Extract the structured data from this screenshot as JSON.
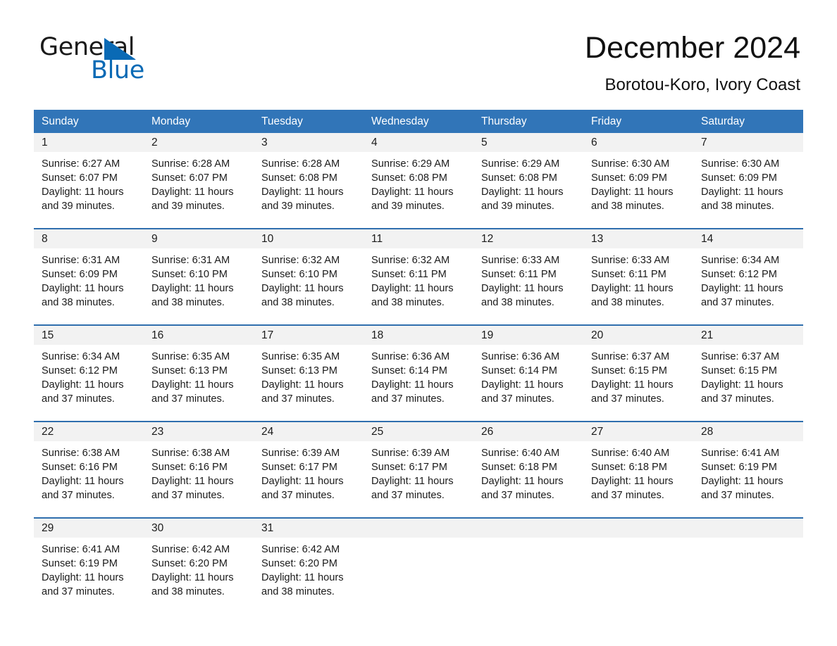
{
  "brand": {
    "name_part1": "General",
    "name_part2": "Blue",
    "triangle_color": "#0a6ab5"
  },
  "header": {
    "month_title": "December 2024",
    "location": "Borotou-Koro, Ivory Coast"
  },
  "theme": {
    "header_blue": "#3175b8",
    "row_divider_blue": "#2f6fae",
    "day_number_band": "#f2f2f2",
    "text_color": "#1b1b1b"
  },
  "calendar": {
    "weekdays": [
      "Sunday",
      "Monday",
      "Tuesday",
      "Wednesday",
      "Thursday",
      "Friday",
      "Saturday"
    ],
    "weeks": [
      [
        {
          "day": "1",
          "sunrise": "Sunrise: 6:27 AM",
          "sunset": "Sunset: 6:07 PM",
          "daylight": "Daylight: 11 hours and 39 minutes."
        },
        {
          "day": "2",
          "sunrise": "Sunrise: 6:28 AM",
          "sunset": "Sunset: 6:07 PM",
          "daylight": "Daylight: 11 hours and 39 minutes."
        },
        {
          "day": "3",
          "sunrise": "Sunrise: 6:28 AM",
          "sunset": "Sunset: 6:08 PM",
          "daylight": "Daylight: 11 hours and 39 minutes."
        },
        {
          "day": "4",
          "sunrise": "Sunrise: 6:29 AM",
          "sunset": "Sunset: 6:08 PM",
          "daylight": "Daylight: 11 hours and 39 minutes."
        },
        {
          "day": "5",
          "sunrise": "Sunrise: 6:29 AM",
          "sunset": "Sunset: 6:08 PM",
          "daylight": "Daylight: 11 hours and 39 minutes."
        },
        {
          "day": "6",
          "sunrise": "Sunrise: 6:30 AM",
          "sunset": "Sunset: 6:09 PM",
          "daylight": "Daylight: 11 hours and 38 minutes."
        },
        {
          "day": "7",
          "sunrise": "Sunrise: 6:30 AM",
          "sunset": "Sunset: 6:09 PM",
          "daylight": "Daylight: 11 hours and 38 minutes."
        }
      ],
      [
        {
          "day": "8",
          "sunrise": "Sunrise: 6:31 AM",
          "sunset": "Sunset: 6:09 PM",
          "daylight": "Daylight: 11 hours and 38 minutes."
        },
        {
          "day": "9",
          "sunrise": "Sunrise: 6:31 AM",
          "sunset": "Sunset: 6:10 PM",
          "daylight": "Daylight: 11 hours and 38 minutes."
        },
        {
          "day": "10",
          "sunrise": "Sunrise: 6:32 AM",
          "sunset": "Sunset: 6:10 PM",
          "daylight": "Daylight: 11 hours and 38 minutes."
        },
        {
          "day": "11",
          "sunrise": "Sunrise: 6:32 AM",
          "sunset": "Sunset: 6:11 PM",
          "daylight": "Daylight: 11 hours and 38 minutes."
        },
        {
          "day": "12",
          "sunrise": "Sunrise: 6:33 AM",
          "sunset": "Sunset: 6:11 PM",
          "daylight": "Daylight: 11 hours and 38 minutes."
        },
        {
          "day": "13",
          "sunrise": "Sunrise: 6:33 AM",
          "sunset": "Sunset: 6:11 PM",
          "daylight": "Daylight: 11 hours and 38 minutes."
        },
        {
          "day": "14",
          "sunrise": "Sunrise: 6:34 AM",
          "sunset": "Sunset: 6:12 PM",
          "daylight": "Daylight: 11 hours and 37 minutes."
        }
      ],
      [
        {
          "day": "15",
          "sunrise": "Sunrise: 6:34 AM",
          "sunset": "Sunset: 6:12 PM",
          "daylight": "Daylight: 11 hours and 37 minutes."
        },
        {
          "day": "16",
          "sunrise": "Sunrise: 6:35 AM",
          "sunset": "Sunset: 6:13 PM",
          "daylight": "Daylight: 11 hours and 37 minutes."
        },
        {
          "day": "17",
          "sunrise": "Sunrise: 6:35 AM",
          "sunset": "Sunset: 6:13 PM",
          "daylight": "Daylight: 11 hours and 37 minutes."
        },
        {
          "day": "18",
          "sunrise": "Sunrise: 6:36 AM",
          "sunset": "Sunset: 6:14 PM",
          "daylight": "Daylight: 11 hours and 37 minutes."
        },
        {
          "day": "19",
          "sunrise": "Sunrise: 6:36 AM",
          "sunset": "Sunset: 6:14 PM",
          "daylight": "Daylight: 11 hours and 37 minutes."
        },
        {
          "day": "20",
          "sunrise": "Sunrise: 6:37 AM",
          "sunset": "Sunset: 6:15 PM",
          "daylight": "Daylight: 11 hours and 37 minutes."
        },
        {
          "day": "21",
          "sunrise": "Sunrise: 6:37 AM",
          "sunset": "Sunset: 6:15 PM",
          "daylight": "Daylight: 11 hours and 37 minutes."
        }
      ],
      [
        {
          "day": "22",
          "sunrise": "Sunrise: 6:38 AM",
          "sunset": "Sunset: 6:16 PM",
          "daylight": "Daylight: 11 hours and 37 minutes."
        },
        {
          "day": "23",
          "sunrise": "Sunrise: 6:38 AM",
          "sunset": "Sunset: 6:16 PM",
          "daylight": "Daylight: 11 hours and 37 minutes."
        },
        {
          "day": "24",
          "sunrise": "Sunrise: 6:39 AM",
          "sunset": "Sunset: 6:17 PM",
          "daylight": "Daylight: 11 hours and 37 minutes."
        },
        {
          "day": "25",
          "sunrise": "Sunrise: 6:39 AM",
          "sunset": "Sunset: 6:17 PM",
          "daylight": "Daylight: 11 hours and 37 minutes."
        },
        {
          "day": "26",
          "sunrise": "Sunrise: 6:40 AM",
          "sunset": "Sunset: 6:18 PM",
          "daylight": "Daylight: 11 hours and 37 minutes."
        },
        {
          "day": "27",
          "sunrise": "Sunrise: 6:40 AM",
          "sunset": "Sunset: 6:18 PM",
          "daylight": "Daylight: 11 hours and 37 minutes."
        },
        {
          "day": "28",
          "sunrise": "Sunrise: 6:41 AM",
          "sunset": "Sunset: 6:19 PM",
          "daylight": "Daylight: 11 hours and 37 minutes."
        }
      ],
      [
        {
          "day": "29",
          "sunrise": "Sunrise: 6:41 AM",
          "sunset": "Sunset: 6:19 PM",
          "daylight": "Daylight: 11 hours and 37 minutes."
        },
        {
          "day": "30",
          "sunrise": "Sunrise: 6:42 AM",
          "sunset": "Sunset: 6:20 PM",
          "daylight": "Daylight: 11 hours and 38 minutes."
        },
        {
          "day": "31",
          "sunrise": "Sunrise: 6:42 AM",
          "sunset": "Sunset: 6:20 PM",
          "daylight": "Daylight: 11 hours and 38 minutes."
        },
        {
          "day": "",
          "sunrise": "",
          "sunset": "",
          "daylight": ""
        },
        {
          "day": "",
          "sunrise": "",
          "sunset": "",
          "daylight": ""
        },
        {
          "day": "",
          "sunrise": "",
          "sunset": "",
          "daylight": ""
        },
        {
          "day": "",
          "sunrise": "",
          "sunset": "",
          "daylight": ""
        }
      ]
    ]
  }
}
